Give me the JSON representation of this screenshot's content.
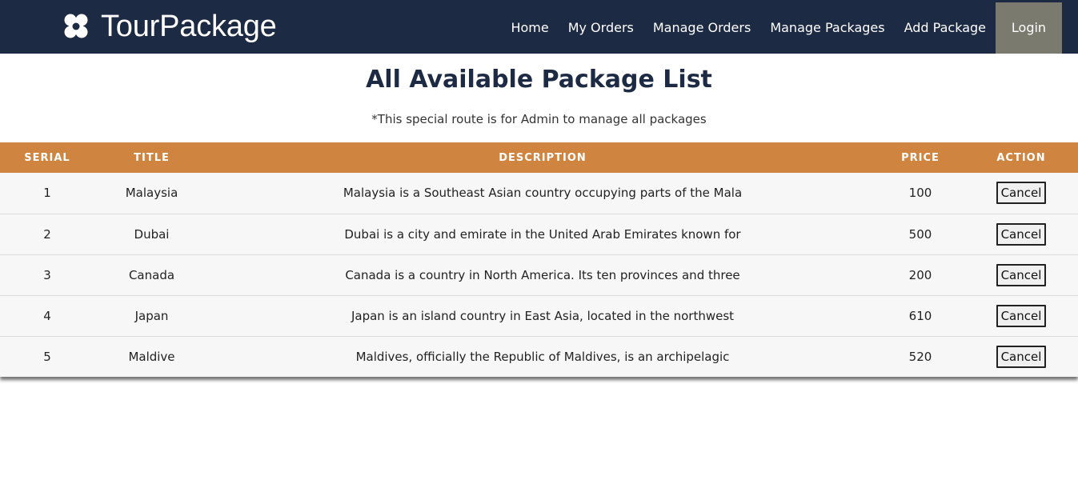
{
  "header": {
    "brand": {
      "light": "Tour",
      "bold": "Package",
      "logo_icon": "flower-logo-icon"
    },
    "nav": [
      {
        "label": "Home"
      },
      {
        "label": "My Orders"
      },
      {
        "label": "Manage Orders"
      },
      {
        "label": "Manage Packages"
      },
      {
        "label": "Add Package"
      }
    ],
    "login_label": "Login"
  },
  "main": {
    "title": "All Available Package List",
    "subtitle": "*This special route is for Admin to manage all packages"
  },
  "table": {
    "columns": [
      "SERIAL",
      "TITLE",
      "DESCRIPTION",
      "PRICE",
      "ACTION"
    ],
    "rows": [
      {
        "serial": "1",
        "title": "Malaysia",
        "description": "Malaysia is a Southeast Asian country occupying parts of the Mala",
        "price": "100",
        "action": "Cancel"
      },
      {
        "serial": "2",
        "title": "Dubai",
        "description": "Dubai is a city and emirate in the United Arab Emirates known for",
        "price": "500",
        "action": "Cancel"
      },
      {
        "serial": "3",
        "title": "Canada",
        "description": "Canada is a country in North America. Its ten provinces and three",
        "price": "200",
        "action": "Cancel"
      },
      {
        "serial": "4",
        "title": "Japan",
        "description": "Japan is an island country in East Asia, located in the northwest",
        "price": "610",
        "action": "Cancel"
      },
      {
        "serial": "5",
        "title": "Maldive",
        "description": "Maldives, officially the Republic of Maldives, is an archipelagic",
        "price": "520",
        "action": "Cancel"
      }
    ]
  },
  "colors": {
    "navbar": "#1d2a44",
    "table_header": "#cf8540",
    "login_bg": "#7b7a6e"
  }
}
